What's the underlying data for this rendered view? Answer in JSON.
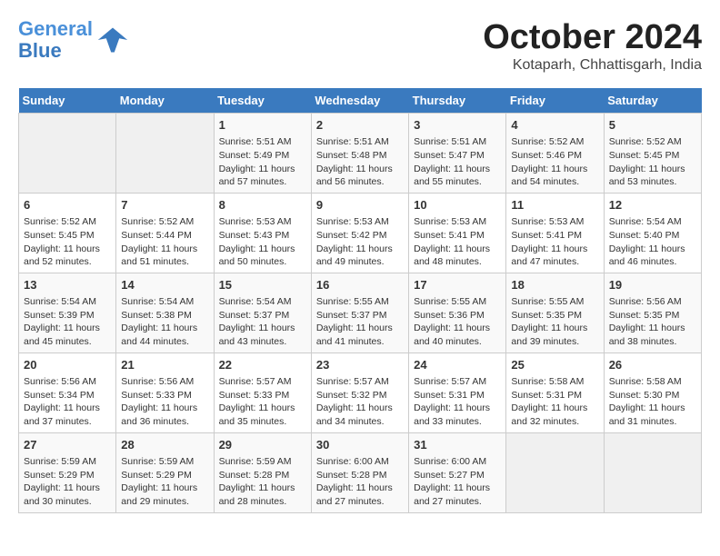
{
  "header": {
    "logo_line1": "General",
    "logo_line2": "Blue",
    "month": "October 2024",
    "location": "Kotaparh, Chhattisgarh, India"
  },
  "days_of_week": [
    "Sunday",
    "Monday",
    "Tuesday",
    "Wednesday",
    "Thursday",
    "Friday",
    "Saturday"
  ],
  "weeks": [
    [
      {
        "day": "",
        "info": ""
      },
      {
        "day": "",
        "info": ""
      },
      {
        "day": "1",
        "info": "Sunrise: 5:51 AM\nSunset: 5:49 PM\nDaylight: 11 hours and 57 minutes."
      },
      {
        "day": "2",
        "info": "Sunrise: 5:51 AM\nSunset: 5:48 PM\nDaylight: 11 hours and 56 minutes."
      },
      {
        "day": "3",
        "info": "Sunrise: 5:51 AM\nSunset: 5:47 PM\nDaylight: 11 hours and 55 minutes."
      },
      {
        "day": "4",
        "info": "Sunrise: 5:52 AM\nSunset: 5:46 PM\nDaylight: 11 hours and 54 minutes."
      },
      {
        "day": "5",
        "info": "Sunrise: 5:52 AM\nSunset: 5:45 PM\nDaylight: 11 hours and 53 minutes."
      }
    ],
    [
      {
        "day": "6",
        "info": "Sunrise: 5:52 AM\nSunset: 5:45 PM\nDaylight: 11 hours and 52 minutes."
      },
      {
        "day": "7",
        "info": "Sunrise: 5:52 AM\nSunset: 5:44 PM\nDaylight: 11 hours and 51 minutes."
      },
      {
        "day": "8",
        "info": "Sunrise: 5:53 AM\nSunset: 5:43 PM\nDaylight: 11 hours and 50 minutes."
      },
      {
        "day": "9",
        "info": "Sunrise: 5:53 AM\nSunset: 5:42 PM\nDaylight: 11 hours and 49 minutes."
      },
      {
        "day": "10",
        "info": "Sunrise: 5:53 AM\nSunset: 5:41 PM\nDaylight: 11 hours and 48 minutes."
      },
      {
        "day": "11",
        "info": "Sunrise: 5:53 AM\nSunset: 5:41 PM\nDaylight: 11 hours and 47 minutes."
      },
      {
        "day": "12",
        "info": "Sunrise: 5:54 AM\nSunset: 5:40 PM\nDaylight: 11 hours and 46 minutes."
      }
    ],
    [
      {
        "day": "13",
        "info": "Sunrise: 5:54 AM\nSunset: 5:39 PM\nDaylight: 11 hours and 45 minutes."
      },
      {
        "day": "14",
        "info": "Sunrise: 5:54 AM\nSunset: 5:38 PM\nDaylight: 11 hours and 44 minutes."
      },
      {
        "day": "15",
        "info": "Sunrise: 5:54 AM\nSunset: 5:37 PM\nDaylight: 11 hours and 43 minutes."
      },
      {
        "day": "16",
        "info": "Sunrise: 5:55 AM\nSunset: 5:37 PM\nDaylight: 11 hours and 41 minutes."
      },
      {
        "day": "17",
        "info": "Sunrise: 5:55 AM\nSunset: 5:36 PM\nDaylight: 11 hours and 40 minutes."
      },
      {
        "day": "18",
        "info": "Sunrise: 5:55 AM\nSunset: 5:35 PM\nDaylight: 11 hours and 39 minutes."
      },
      {
        "day": "19",
        "info": "Sunrise: 5:56 AM\nSunset: 5:35 PM\nDaylight: 11 hours and 38 minutes."
      }
    ],
    [
      {
        "day": "20",
        "info": "Sunrise: 5:56 AM\nSunset: 5:34 PM\nDaylight: 11 hours and 37 minutes."
      },
      {
        "day": "21",
        "info": "Sunrise: 5:56 AM\nSunset: 5:33 PM\nDaylight: 11 hours and 36 minutes."
      },
      {
        "day": "22",
        "info": "Sunrise: 5:57 AM\nSunset: 5:33 PM\nDaylight: 11 hours and 35 minutes."
      },
      {
        "day": "23",
        "info": "Sunrise: 5:57 AM\nSunset: 5:32 PM\nDaylight: 11 hours and 34 minutes."
      },
      {
        "day": "24",
        "info": "Sunrise: 5:57 AM\nSunset: 5:31 PM\nDaylight: 11 hours and 33 minutes."
      },
      {
        "day": "25",
        "info": "Sunrise: 5:58 AM\nSunset: 5:31 PM\nDaylight: 11 hours and 32 minutes."
      },
      {
        "day": "26",
        "info": "Sunrise: 5:58 AM\nSunset: 5:30 PM\nDaylight: 11 hours and 31 minutes."
      }
    ],
    [
      {
        "day": "27",
        "info": "Sunrise: 5:59 AM\nSunset: 5:29 PM\nDaylight: 11 hours and 30 minutes."
      },
      {
        "day": "28",
        "info": "Sunrise: 5:59 AM\nSunset: 5:29 PM\nDaylight: 11 hours and 29 minutes."
      },
      {
        "day": "29",
        "info": "Sunrise: 5:59 AM\nSunset: 5:28 PM\nDaylight: 11 hours and 28 minutes."
      },
      {
        "day": "30",
        "info": "Sunrise: 6:00 AM\nSunset: 5:28 PM\nDaylight: 11 hours and 27 minutes."
      },
      {
        "day": "31",
        "info": "Sunrise: 6:00 AM\nSunset: 5:27 PM\nDaylight: 11 hours and 27 minutes."
      },
      {
        "day": "",
        "info": ""
      },
      {
        "day": "",
        "info": ""
      }
    ]
  ]
}
